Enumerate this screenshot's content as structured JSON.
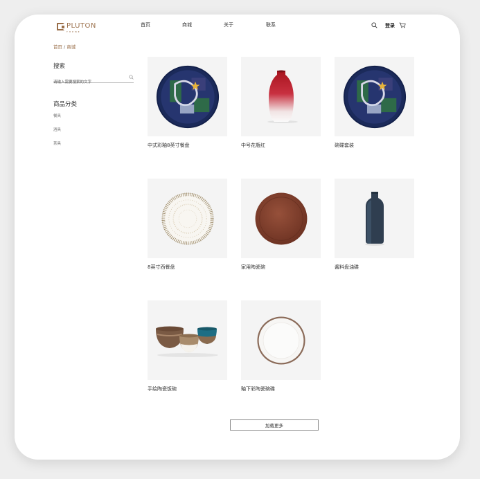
{
  "brand": {
    "name": "PLUTON",
    "sub": "THEME",
    "color": "#9a6f4a"
  },
  "nav": [
    "首页",
    "商城",
    "关于",
    "联系"
  ],
  "header": {
    "login": "登录",
    "icons": [
      "search-icon",
      "cart-icon"
    ]
  },
  "breadcrumb": {
    "home": "首页",
    "separator": "/",
    "current": "商城"
  },
  "sidebar": {
    "search_title": "搜索",
    "search_placeholder": "请输入需要搜索的文字",
    "category_title": "商品分类",
    "categories": [
      "餐具",
      "酒具",
      "茶具"
    ]
  },
  "products": [
    {
      "name": "中式彩釉8英寸餐盘",
      "image": "decorated-plate"
    },
    {
      "name": "中号花瓶红",
      "image": "red-vase"
    },
    {
      "name": "碗碟套装",
      "image": "decorated-plate"
    },
    {
      "name": "8英寸西餐盘",
      "image": "striped-plate"
    },
    {
      "name": "家用陶瓷碗",
      "image": "brown-plate"
    },
    {
      "name": "酱料盘油碟",
      "image": "blue-bottle"
    },
    {
      "name": "手绘陶瓷饭碗",
      "image": "bowls"
    },
    {
      "name": "釉下彩陶瓷碗碟",
      "image": "white-plate"
    }
  ],
  "load_more": "加载更多"
}
